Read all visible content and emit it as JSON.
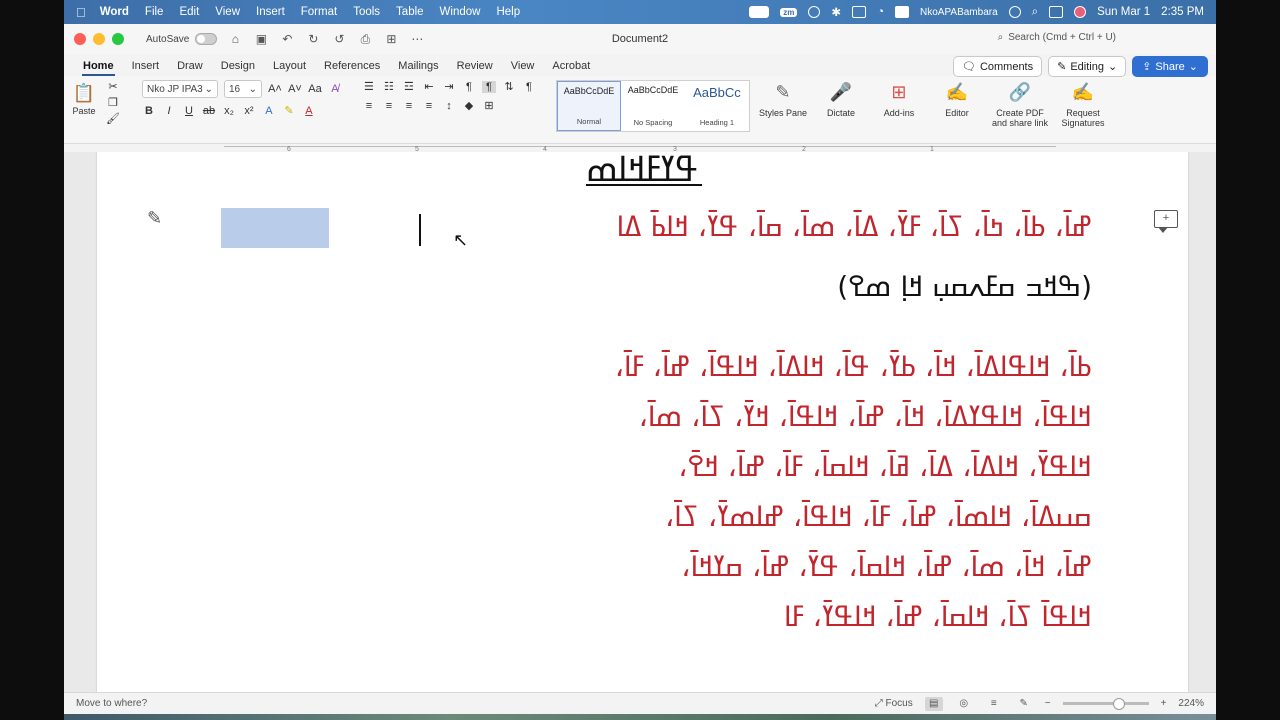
{
  "menubar": {
    "items": [
      "Word",
      "File",
      "Edit",
      "View",
      "Insert",
      "Format",
      "Tools",
      "Table",
      "Window",
      "Help"
    ],
    "keyboard_label": "NkoAPABambara",
    "date": "Sun Mar 1",
    "time": "2:35 PM",
    "zoom_badge": "zm"
  },
  "window": {
    "autosave_label": "AutoSave",
    "document_title": "Document2",
    "search_placeholder": "Search (Cmd + Ctrl + U)"
  },
  "tabs": [
    "Home",
    "Insert",
    "Draw",
    "Design",
    "Layout",
    "References",
    "Mailings",
    "Review",
    "View",
    "Acrobat"
  ],
  "tab_actions": {
    "comments": "Comments",
    "editing": "Editing",
    "share": "Share"
  },
  "ribbon": {
    "paste_label": "Paste",
    "font_name": "Nko JP IPA3",
    "font_size": "16",
    "styles": [
      {
        "sample": "AaBbCcDdE",
        "name": "Normal"
      },
      {
        "sample": "AaBbCcDdE",
        "name": "No Spacing"
      },
      {
        "sample": "AaBbCc",
        "name": "Heading 1"
      }
    ],
    "tools": [
      {
        "label": "Styles Pane",
        "icon": "styles-pane-icon"
      },
      {
        "label": "Dictate",
        "icon": "microphone-icon"
      },
      {
        "label": "Add-ins",
        "icon": "add-ins-icon"
      },
      {
        "label": "Editor",
        "icon": "editor-icon"
      },
      {
        "label": "Create PDF and share link",
        "icon": "pdf-icon"
      },
      {
        "label": "Request Signatures",
        "icon": "signature-icon"
      }
    ]
  },
  "ruler": {
    "marks": [
      "6",
      "5",
      "4",
      "3",
      "2",
      "1"
    ]
  },
  "document": {
    "heading": "ߟߌߓߞߊߘ",
    "lines": [
      "ߝߊ߫، ߕߊ߫، ߤߊ߫، ߖߊ߫، ߓߌ߫، ߡߊ߫، ߘߊ߫، ߛߊ߫، ߟߌ߫، ߞߊߕ߫ ߡߊ",
      "(ߒߞߏ ߛߓߍߛߎ߲ ߞߊ߲ ߘߐ)",
      "ߕߊ߫، ߞߊߟߊߡߊ߫، ߞߊ߫، ߕߌ߫، ߟߊ߫، ߞߊߡߊ߫، ߞߊߟߊ߫، ߝߊ߫، ߓߊ߫،",
      "ߞߊߟߊ߫، ߞߊߟߌߡߊ߫، ߞߊ߫، ߝߊ߫، ߞߊߟߊ߫، ߞߌ߫، ߖߊ߫، ߘߊ߫،",
      "ߞߊߟߌ߫، ߞߊߡߊ߫، ߡߊ߫، ߥߊ߫، ߞߊߛߊ߫، ߓߊ߫، ߝߊ߫، ߞߐ߫،",
      "ߛߎߡߊ߫، ߞߊߘߊ߫، ߝߊ߫، ߓߊ߫، ߞߊߟߊ߫، ߝߊߘߌ߫، ߖߊ߫،",
      "ߝߊ߫، ߞߊ߫، ߘߊ߫، ߝߊ߫، ߞߊߛߊ߫، ߟߌ߫، ߝߊ߫، ߛߌߞߊ߫،",
      "ߞߊߟߊ߫ ߖߊ߫، ߞߊߛߊ߫، ߝߊ߫، ߞߊߟߌ߫، ߓߊ"
    ]
  },
  "statusbar": {
    "left": "Move to where?",
    "focus": "Focus",
    "zoom": "224%"
  },
  "colors": {
    "menubar": "#4a86c4",
    "text_red": "#c0262d",
    "accent": "#2b5797",
    "share": "#2f6fd1"
  }
}
